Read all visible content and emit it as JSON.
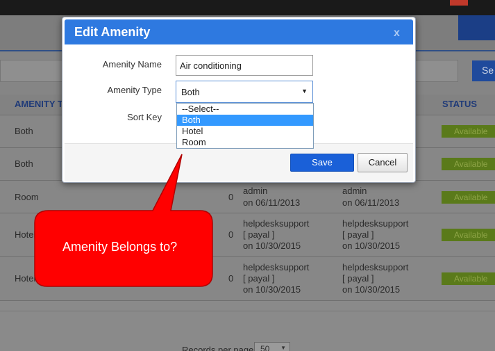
{
  "modal": {
    "title": "Edit Amenity",
    "close_label": "x",
    "fields": {
      "name_label": "Amenity Name",
      "name_value": "Air conditioning",
      "type_label": "Amenity Type",
      "type_value": "Both",
      "sort_label": "Sort Key"
    },
    "dropdown_options": [
      "--Select--",
      "Both",
      "Hotel",
      "Room"
    ],
    "dropdown_selected": "Both",
    "save_label": "Save",
    "cancel_label": "Cancel"
  },
  "callout": {
    "text": "Amenity Belongs to?",
    "color": "#ff0000"
  },
  "background": {
    "search_label": "Se",
    "table": {
      "headers": [
        "AMENITY T",
        "STATUS"
      ],
      "rows": [
        {
          "type": "Both",
          "status": "Available"
        },
        {
          "type": "Both",
          "status": "Available"
        },
        {
          "type": "Room",
          "count": "0",
          "created_by": "admin",
          "created_on": "on 06/11/2013",
          "updated_by": "admin",
          "updated_on": "on 06/11/2013",
          "status": "Available"
        },
        {
          "type": "Hotel",
          "count": "0",
          "created_by": "helpdesksupport",
          "created_user": "[ payal ]",
          "created_on": "on 10/30/2015",
          "updated_by": "helpdesksupport",
          "updated_user": "[ payal ]",
          "updated_on": "on 10/30/2015",
          "status": "Available"
        },
        {
          "type": "Hotel",
          "count": "0",
          "created_by": "helpdesksupport",
          "created_user": "[ payal ]",
          "created_on": "on 10/30/2015",
          "updated_by": "helpdesksupport",
          "updated_user": "[ payal ]",
          "updated_on": "on 10/30/2015",
          "status": "Available"
        }
      ]
    },
    "records_per_page_label": "Records per page",
    "records_per_page_value": "50"
  },
  "colors": {
    "modal_header": "#2e79e0",
    "save_button": "#1a60d8",
    "status_badge": "#5a7a1a",
    "overlay": "#8a8a8a"
  }
}
